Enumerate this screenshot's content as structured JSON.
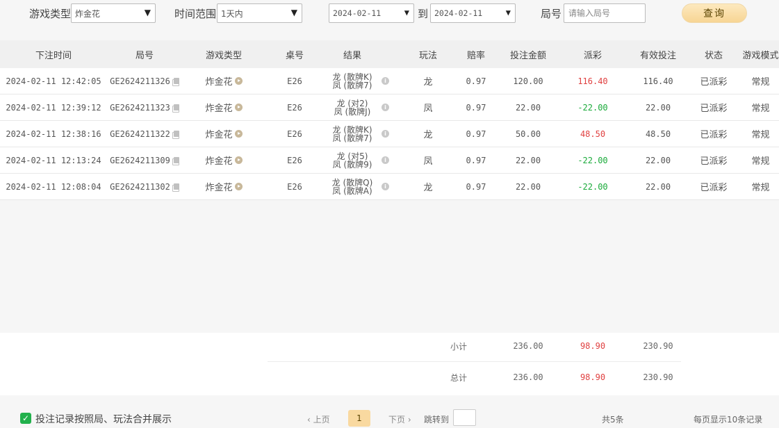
{
  "filters": {
    "game_type_label": "游戏类型",
    "game_type_value": "炸金花",
    "time_range_label": "时间范围",
    "time_range_value": "1天内",
    "date_from": "2024-02-11",
    "date_sep": "到",
    "date_to": "2024-02-11",
    "round_label": "局号",
    "round_placeholder": "请输入局号",
    "query_button": "查询",
    "caret_glyph": "▼"
  },
  "table": {
    "columns": [
      "下注时间",
      "局号",
      "游戏类型",
      "桌号",
      "结果",
      "玩法",
      "赔率",
      "投注金额",
      "派彩",
      "有效投注",
      "状态",
      "游戏模式"
    ],
    "rows": [
      {
        "time": "2024-02-11 12:42:05",
        "round": "GE2624211326",
        "game": "炸金花",
        "table": "E26",
        "result_line1": "龙 (散牌K)",
        "result_line2": "凤 (散牌7)",
        "play": "龙",
        "odds": "0.97",
        "bet": "120.00",
        "payout": "116.40",
        "payout_sign": "pos",
        "valid_bet": "116.40",
        "status": "已派彩",
        "mode": "常规"
      },
      {
        "time": "2024-02-11 12:39:12",
        "round": "GE2624211323",
        "game": "炸金花",
        "table": "E26",
        "result_line1": "龙 (对2)",
        "result_line2": "凤 (散牌J)",
        "play": "凤",
        "odds": "0.97",
        "bet": "22.00",
        "payout": "-22.00",
        "payout_sign": "neg",
        "valid_bet": "22.00",
        "status": "已派彩",
        "mode": "常规"
      },
      {
        "time": "2024-02-11 12:38:16",
        "round": "GE2624211322",
        "game": "炸金花",
        "table": "E26",
        "result_line1": "龙 (散牌K)",
        "result_line2": "凤 (散牌7)",
        "play": "龙",
        "odds": "0.97",
        "bet": "50.00",
        "payout": "48.50",
        "payout_sign": "pos",
        "valid_bet": "48.50",
        "status": "已派彩",
        "mode": "常规"
      },
      {
        "time": "2024-02-11 12:13:24",
        "round": "GE2624211309",
        "game": "炸金花",
        "table": "E26",
        "result_line1": "龙 (对5)",
        "result_line2": "凤 (散牌9)",
        "play": "凤",
        "odds": "0.97",
        "bet": "22.00",
        "payout": "-22.00",
        "payout_sign": "neg",
        "valid_bet": "22.00",
        "status": "已派彩",
        "mode": "常规"
      },
      {
        "time": "2024-02-11 12:08:04",
        "round": "GE2624211302",
        "game": "炸金花",
        "table": "E26",
        "result_line1": "龙 (散牌Q)",
        "result_line2": "凤 (散牌A)",
        "play": "龙",
        "odds": "0.97",
        "bet": "22.00",
        "payout": "-22.00",
        "payout_sign": "neg",
        "valid_bet": "22.00",
        "status": "已派彩",
        "mode": "常规"
      }
    ]
  },
  "summary": {
    "subtotal": {
      "label": "小计",
      "bet": "236.00",
      "payout": "98.90",
      "valid_bet": "230.90"
    },
    "total": {
      "label": "总计",
      "bet": "236.00",
      "payout": "98.90",
      "valid_bet": "230.90"
    }
  },
  "footer": {
    "merge_label": "投注记录按照局、玩法合并展示",
    "merge_checked": true,
    "prev_page": "‹ 上页",
    "current_page": "1",
    "next_page": "下页 ›",
    "jump_label": "跳转到",
    "total_count": "共5条",
    "page_size": "每页显示10条记录"
  },
  "colors": {
    "accent_gold": "#f9d9a0",
    "positive": "#e04040",
    "negative": "#1aaa3a",
    "checkbox": "#22b14c"
  },
  "icons": {
    "copy": "copy-icon",
    "play": "play-circle-icon",
    "info": "info-icon",
    "check": "checkmark-icon"
  }
}
